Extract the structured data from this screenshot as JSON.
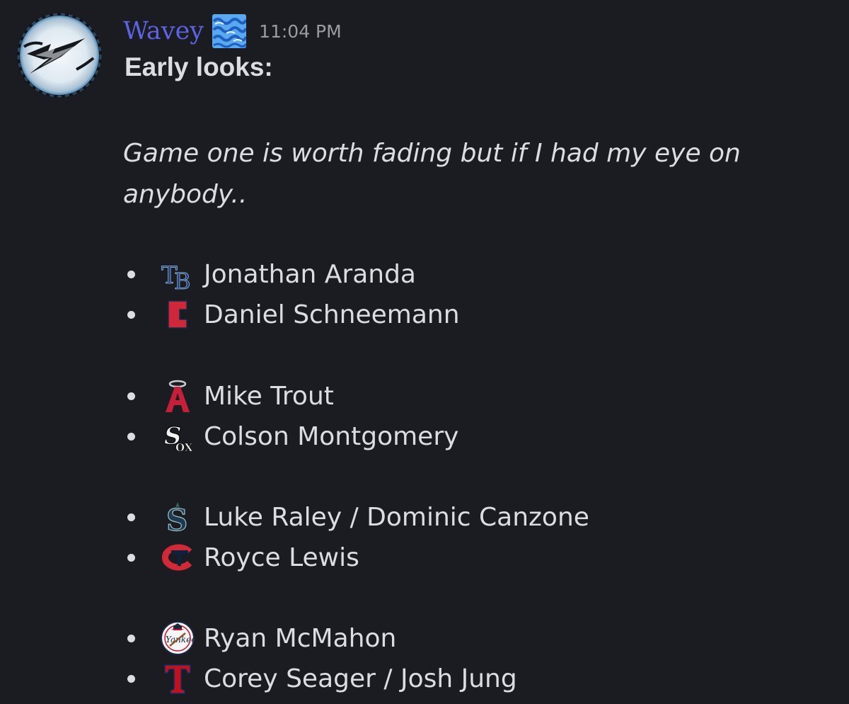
{
  "author": {
    "name": "Wavey",
    "badge_icon": "wave-emoji-icon",
    "name_color": "#5c64e3"
  },
  "message": {
    "timestamp": "11:04 PM",
    "title": "Early looks:",
    "intro": "Game one is worth fading but if I had my eye on anybody..",
    "picks": [
      {
        "team_icon": "rays-logo-icon",
        "player": "Jonathan Aranda"
      },
      {
        "team_icon": "guardians-logo-icon",
        "player": "Daniel Schneemann"
      },
      {
        "team_icon": "angels-logo-icon",
        "player": "Mike Trout"
      },
      {
        "team_icon": "white-sox-logo-icon",
        "player": "Colson Montgomery"
      },
      {
        "team_icon": "mariners-logo-icon",
        "player": "Luke Raley / Dominic Canzone"
      },
      {
        "team_icon": "twins-logo-icon",
        "player": "Royce Lewis"
      },
      {
        "team_icon": "yankees-logo-icon",
        "player": "Ryan McMahon"
      },
      {
        "team_icon": "rangers-logo-icon",
        "player": "Corey Seager / Josh Jung"
      }
    ]
  },
  "colors": {
    "background": "#1b1c21",
    "text": "#dcdde1",
    "timestamp": "#9a9ca3"
  }
}
